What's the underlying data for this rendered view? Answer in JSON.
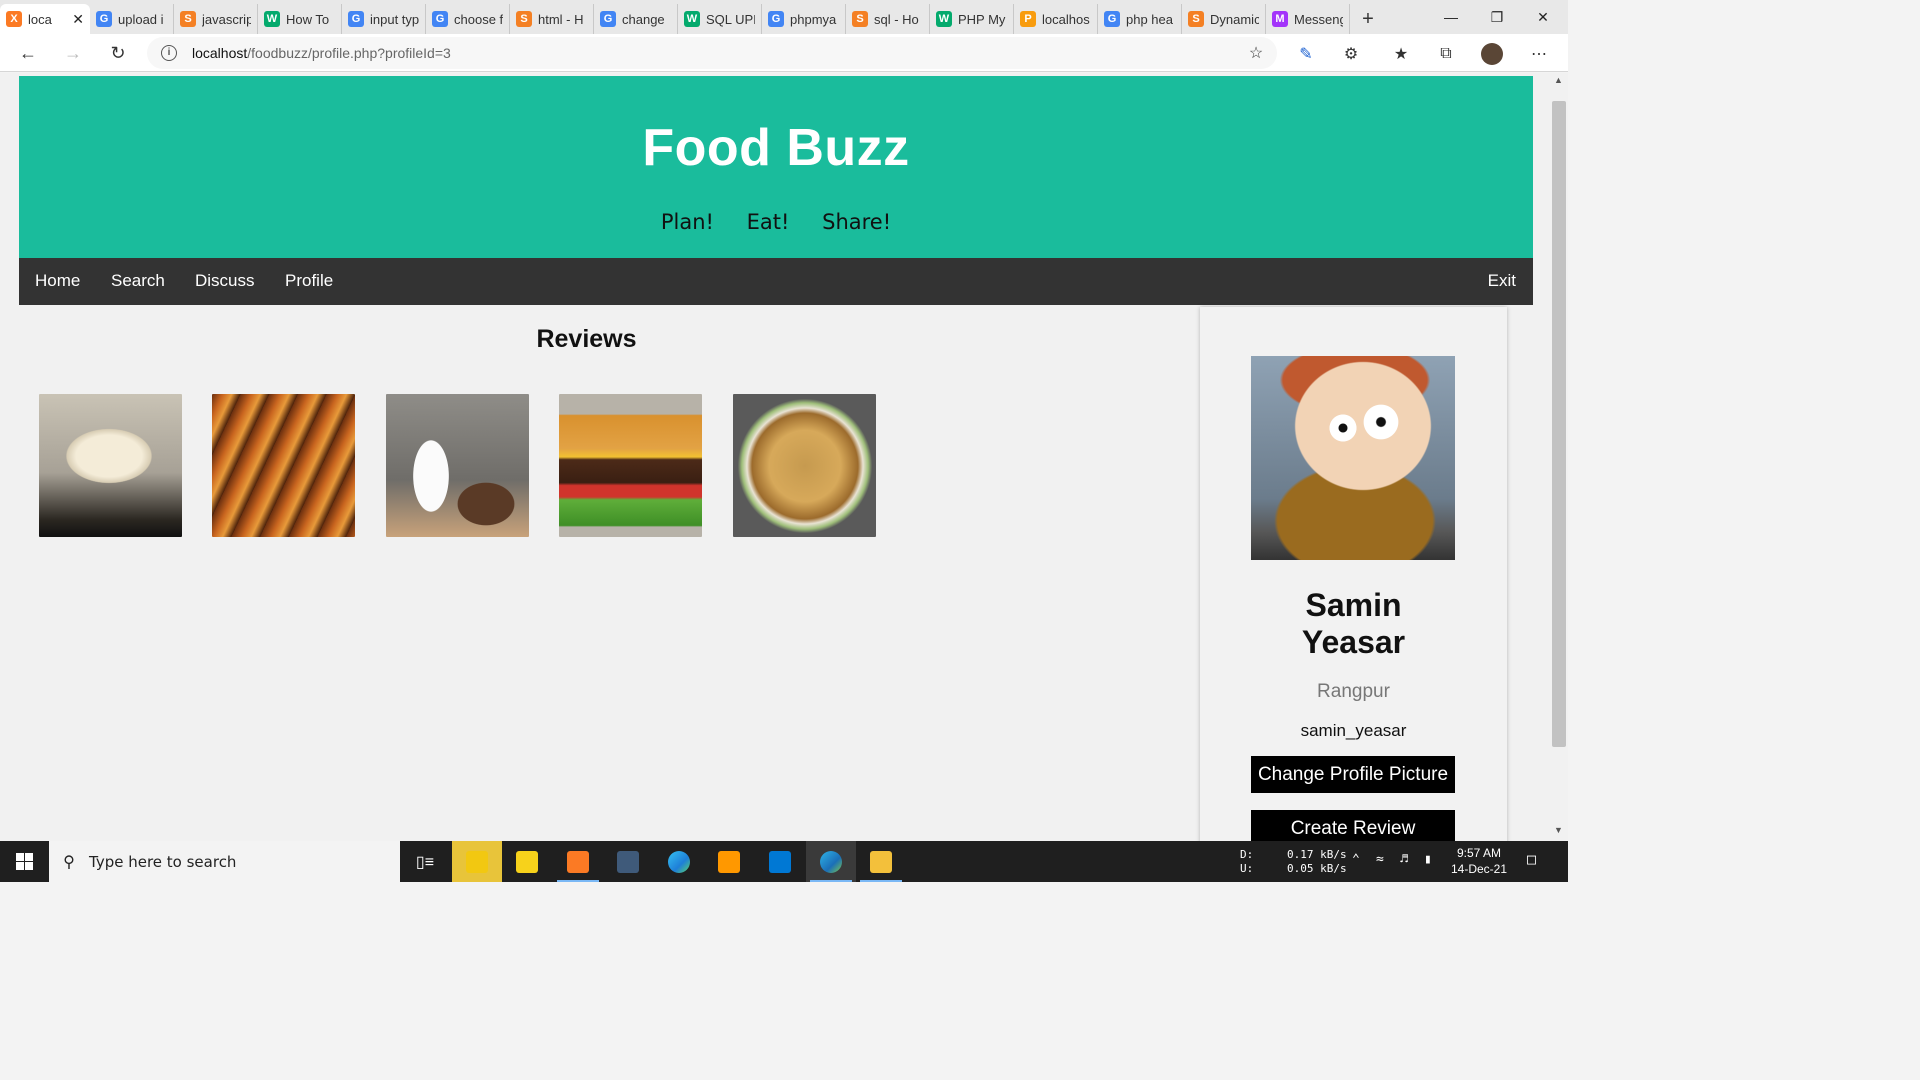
{
  "browser": {
    "tabs": [
      {
        "label": "loca",
        "favicon": "xampp",
        "color": "#fb7a24",
        "active": true
      },
      {
        "label": "upload i",
        "favicon": "google",
        "color": "#4285f4"
      },
      {
        "label": "javascrip",
        "favicon": "stackoverflow",
        "color": "#f48024"
      },
      {
        "label": "How To",
        "favicon": "w3schools",
        "color": "#04aa6d"
      },
      {
        "label": "input typ",
        "favicon": "google",
        "color": "#4285f4"
      },
      {
        "label": "choose f",
        "favicon": "google",
        "color": "#4285f4"
      },
      {
        "label": "html - H",
        "favicon": "stackoverflow",
        "color": "#f48024"
      },
      {
        "label": "change",
        "favicon": "google",
        "color": "#4285f4"
      },
      {
        "label": "SQL UPD",
        "favicon": "w3schools",
        "color": "#04aa6d"
      },
      {
        "label": "phpmya",
        "favicon": "google",
        "color": "#4285f4"
      },
      {
        "label": "sql - Ho",
        "favicon": "stackoverflow",
        "color": "#f48024"
      },
      {
        "label": "PHP My",
        "favicon": "w3schools",
        "color": "#04aa6d"
      },
      {
        "label": "localhos",
        "favicon": "phpmyadmin",
        "color": "#f89c0e"
      },
      {
        "label": "php hea",
        "favicon": "google",
        "color": "#4285f4"
      },
      {
        "label": "Dynamic",
        "favicon": "stackoverflow",
        "color": "#f48024"
      },
      {
        "label": "Messeng",
        "favicon": "messenger",
        "color": "#a334fa"
      }
    ],
    "url_host": "localhost",
    "url_path": "/foodbuzz/profile.php?profileId=3"
  },
  "site": {
    "title": "Food Buzz",
    "tagline": [
      "Plan!",
      "Eat!",
      "Share!"
    ],
    "accent": "#1abc9c"
  },
  "nav": {
    "home": "Home",
    "search": "Search",
    "discuss": "Discuss",
    "profile": "Profile",
    "exit": "Exit"
  },
  "reviews": {
    "heading": "Reviews",
    "items": [
      {
        "name": "rice-pudding-photo"
      },
      {
        "name": "grilled-sandwich-photo"
      },
      {
        "name": "milk-and-bread-photo"
      },
      {
        "name": "burger-photo"
      },
      {
        "name": "biryani-photo"
      }
    ]
  },
  "profile": {
    "first_name": "Samin",
    "last_name": "Yeasar",
    "city": "Rangpur",
    "username": "samin_yeasar",
    "change_picture_label": "Change Profile Picture",
    "create_review_label": "Create Review"
  },
  "taskbar": {
    "search_placeholder": "Type here to search",
    "net_down_label": "D:",
    "net_up_label": "U:",
    "net_down": "0.17 kB/s",
    "net_up": "0.05 kB/s",
    "time": "9:57 AM",
    "date": "14-Dec-21"
  }
}
